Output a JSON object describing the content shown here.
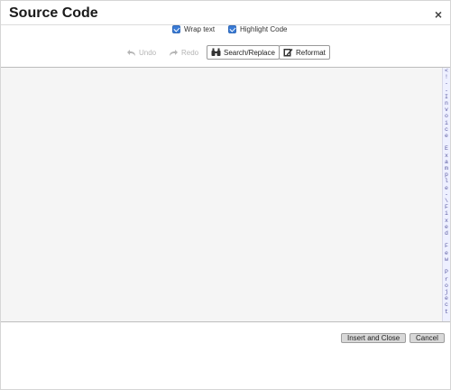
{
  "dialog": {
    "title": "Source Code",
    "close_label": "×"
  },
  "options": {
    "wrap_text": {
      "label": "Wrap text",
      "checked": true
    },
    "highlight_code": {
      "label": "Highlight Code",
      "checked": true
    }
  },
  "toolbar": {
    "undo_label": "Undo",
    "redo_label": "Redo",
    "search_replace_label": "Search/Replace",
    "reformat_label": "Reformat"
  },
  "editor": {
    "gutter_text": "<!--Invoice Example-\\Fixed Few Project"
  },
  "footer": {
    "insert_close_label": "Insert and Close",
    "cancel_label": "Cancel"
  },
  "colors": {
    "checkbox": "#3a7bd5",
    "editor_bg": "#f5f5f5",
    "button_bg": "#d8d8d8"
  }
}
